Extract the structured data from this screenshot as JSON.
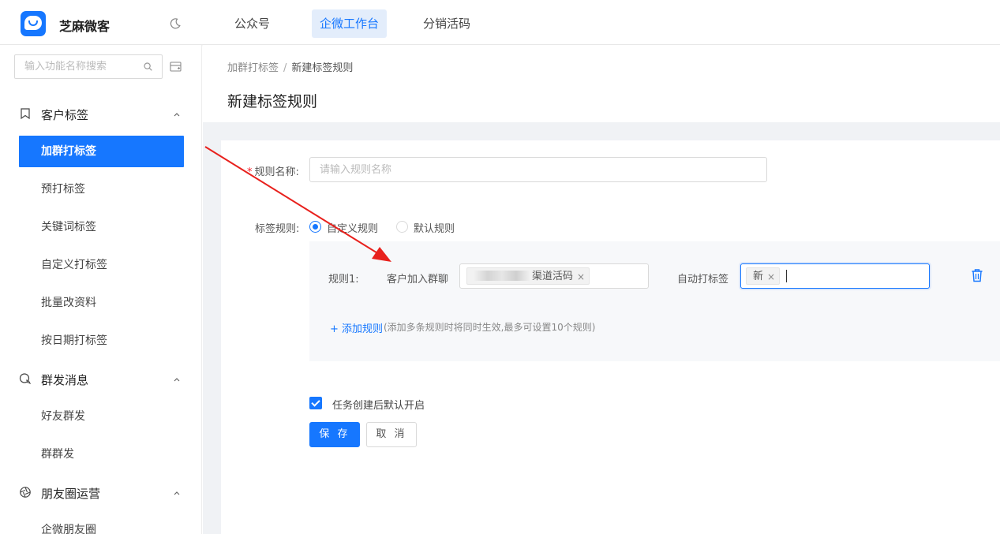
{
  "header": {
    "app_name": "芝麻微客",
    "nav": [
      "公众号",
      "企微工作台",
      "分销活码"
    ],
    "active_nav": "企微工作台"
  },
  "sidebar": {
    "search_placeholder": "输入功能名称搜索",
    "groups": [
      {
        "label": "客户标签",
        "icon": "bookmark-icon",
        "items": [
          "加群打标签",
          "预打标签",
          "关键词标签",
          "自定义打标签",
          "批量改资料",
          "按日期打标签"
        ]
      },
      {
        "label": "群发消息",
        "icon": "chat-icon",
        "items": [
          "好友群发",
          "群群发"
        ]
      },
      {
        "label": "朋友圈运营",
        "icon": "aperture-icon",
        "items": [
          "企微朋友圈"
        ]
      }
    ],
    "active_item": "加群打标签"
  },
  "breadcrumb": {
    "parent": "加群打标签",
    "separator": "/",
    "current": "新建标签规则"
  },
  "page_title": "新建标签规则",
  "form": {
    "name_label": "规则名称:",
    "name_required_mark": "*",
    "name_placeholder": "请输入规则名称",
    "name_value": "",
    "rule_type_label": "标签规则:",
    "rule_options": [
      "自定义规则",
      "默认规则"
    ],
    "rule_selected": "自定义规则",
    "rules": [
      {
        "title": "规则1:",
        "condition_label": "客户加入群聊",
        "group_chip": "渠道活码",
        "action_label": "自动打标签",
        "tag_chip": "新"
      }
    ],
    "add_rule_label": "+ 添加规则",
    "add_rule_hint": "(添加多条规则时将同时生效,最多可设置10个规则)",
    "auto_enable_label": "任务创建后默认开启",
    "auto_enable_checked": true,
    "save_label": "保 存",
    "cancel_label": "取 消"
  },
  "colors": {
    "accent": "#1677ff",
    "annotation_arrow": "#e8211d",
    "background": "#f0f2f5"
  }
}
